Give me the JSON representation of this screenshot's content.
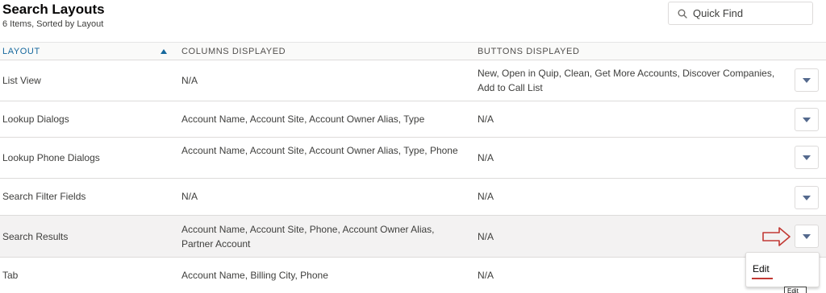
{
  "header": {
    "title": "Search Layouts",
    "subtitle": "6 Items, Sorted by Layout",
    "search_placeholder": "Quick Find"
  },
  "table": {
    "columns": [
      "LAYOUT",
      "COLUMNS DISPLAYED",
      "BUTTONS DISPLAYED"
    ],
    "sorted_column": "LAYOUT",
    "sort_direction": "ascending",
    "rows": [
      {
        "layout": "List View",
        "columns": "N/A",
        "buttons": "New, Open in Quip, Clean, Get More Accounts, Discover Companies, Add to Call List"
      },
      {
        "layout": "Lookup Dialogs",
        "columns": "Account Name, Account Site, Account Owner Alias, Type",
        "buttons": "N/A"
      },
      {
        "layout": "Lookup Phone Dialogs",
        "columns": "Account Name, Account Site, Account Owner Alias, Type, Phone",
        "buttons": "N/A"
      },
      {
        "layout": "Search Filter Fields",
        "columns": "N/A",
        "buttons": "N/A"
      },
      {
        "layout": "Search Results",
        "columns": "Account Name, Account Site, Phone, Account Owner Alias, Partner Account",
        "buttons": "N/A"
      },
      {
        "layout": "Tab",
        "columns": "Account Name, Billing City, Phone",
        "buttons": "N/A"
      }
    ]
  },
  "row_menu": {
    "open_row": "Search Results",
    "items": [
      "Edit"
    ],
    "tooltip": "Edit"
  },
  "icons": {
    "search": "search-icon",
    "sort": "sort-ascending-icon",
    "row_action": "chevron-down-icon",
    "annotation": "red-arrow-icon"
  },
  "colors": {
    "sorted_header": "#16689d",
    "annotation": "#c23934",
    "hover_row": "#f3f2f2"
  }
}
